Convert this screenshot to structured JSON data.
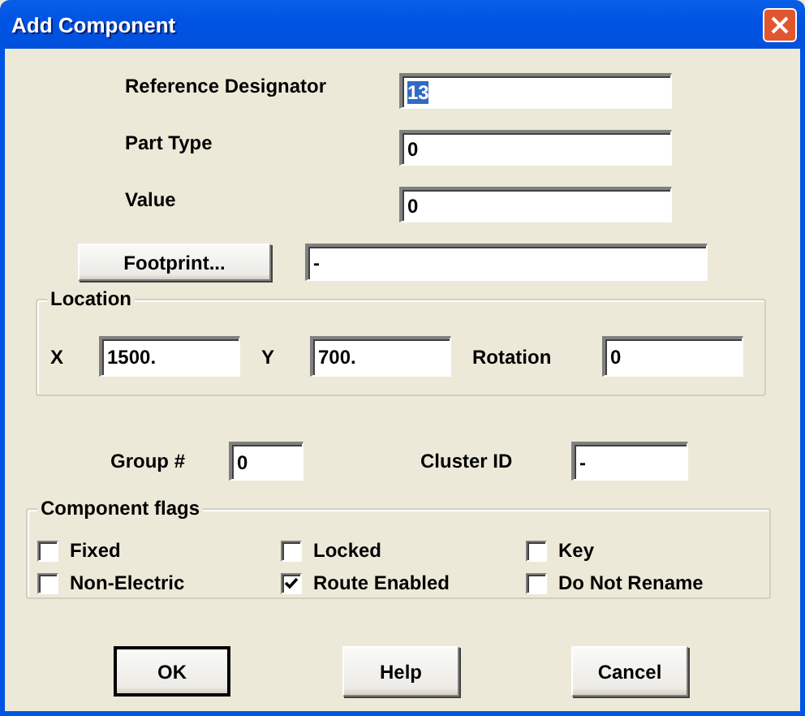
{
  "window": {
    "title": "Add Component"
  },
  "fields": [
    {
      "label": "Reference Designator",
      "value": "13",
      "highlighted": true
    },
    {
      "label": "Part Type",
      "value": "0",
      "highlighted": false
    },
    {
      "label": "Value",
      "value": "0",
      "highlighted": false
    }
  ],
  "footprint": {
    "button": "Footprint...",
    "value": "-"
  },
  "location": {
    "title": "Location",
    "fields": [
      {
        "label": "X",
        "value": "1500."
      },
      {
        "label": "Y",
        "value": "700."
      },
      {
        "label": "Rotation",
        "value": "0"
      }
    ]
  },
  "ids": [
    {
      "label": "Group #",
      "value": "0"
    },
    {
      "label": "Cluster ID",
      "value": "-"
    }
  ],
  "flags": {
    "title": "Component flags",
    "items": [
      {
        "label": "Fixed",
        "checked": false
      },
      {
        "label": "Locked",
        "checked": false
      },
      {
        "label": "Key",
        "checked": false
      },
      {
        "label": "Non-Electric",
        "checked": false
      },
      {
        "label": "Route Enabled",
        "checked": true
      },
      {
        "label": "Do Not Rename",
        "checked": false
      }
    ]
  },
  "buttons": [
    {
      "label": "OK",
      "default": true
    },
    {
      "label": "Help",
      "default": false
    },
    {
      "label": "Cancel",
      "default": false
    }
  ]
}
